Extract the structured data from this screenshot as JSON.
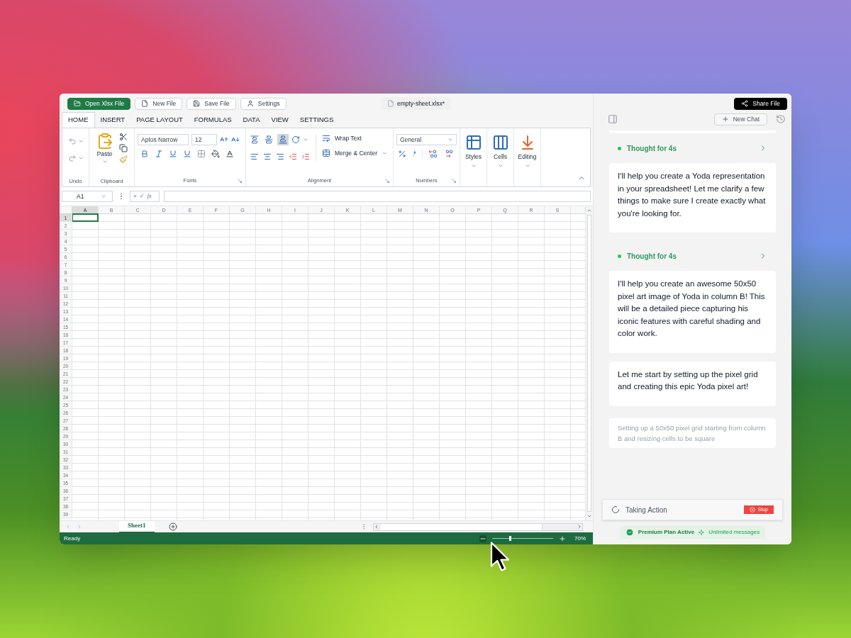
{
  "toolbar": {
    "buttons": [
      {
        "label": "Open Xlsx File",
        "kind": "primary"
      },
      {
        "label": "New File",
        "kind": "default"
      },
      {
        "label": "Save File",
        "kind": "default"
      },
      {
        "label": "Settings",
        "kind": "default"
      }
    ],
    "file_name": "empty-sheet.xlsx*"
  },
  "ribbon": {
    "tabs": [
      {
        "label": "HOME",
        "selected": true
      },
      {
        "label": "INSERT",
        "selected": false
      },
      {
        "label": "PAGE LAYOUT",
        "selected": false
      },
      {
        "label": "FORMULAS",
        "selected": false
      },
      {
        "label": "DATA",
        "selected": false
      },
      {
        "label": "VIEW",
        "selected": false
      },
      {
        "label": "SETTINGS",
        "selected": false
      }
    ],
    "undo": {
      "label": "Undo"
    },
    "clipboard": {
      "label": "Clipboard",
      "paste": "Paste"
    },
    "fonts": {
      "label": "Fonts",
      "font": "Aptos Narrow",
      "size": "12"
    },
    "alignment": {
      "label": "Alignment",
      "wrap_text": "Wrap Text",
      "merge": "Merge & Center",
      "vertical_align": [
        {
          "selected": false
        },
        {
          "selected": false
        },
        {
          "selected": true
        }
      ]
    },
    "numbers": {
      "label": "Numbers",
      "format": "General"
    },
    "styles": "Styles",
    "cells": "Cells",
    "editing": "Editing"
  },
  "formula_bar": {
    "cell_ref": "A1",
    "cancel": "×",
    "confirm": "✓",
    "fx": "fx"
  },
  "sheet": {
    "columns": [
      {
        "label": "A",
        "selected": true
      },
      {
        "label": "B",
        "selected": false
      },
      {
        "label": "C",
        "selected": false
      },
      {
        "label": "D",
        "selected": false
      },
      {
        "label": "E",
        "selected": false
      },
      {
        "label": "F",
        "selected": false
      },
      {
        "label": "G",
        "selected": false
      },
      {
        "label": "H",
        "selected": false
      },
      {
        "label": "I",
        "selected": false
      },
      {
        "label": "J",
        "selected": false
      },
      {
        "label": "K",
        "selected": false
      },
      {
        "label": "L",
        "selected": false
      },
      {
        "label": "M",
        "selected": false
      },
      {
        "label": "N",
        "selected": false
      },
      {
        "label": "O",
        "selected": false
      },
      {
        "label": "P",
        "selected": false
      },
      {
        "label": "Q",
        "selected": false
      },
      {
        "label": "R",
        "selected": false
      },
      {
        "label": "S",
        "selected": false
      }
    ],
    "rows": [
      {
        "label": "1",
        "selected": true
      },
      {
        "label": "2",
        "selected": false
      },
      {
        "label": "3",
        "selected": false
      },
      {
        "label": "4",
        "selected": false
      },
      {
        "label": "5",
        "selected": false
      },
      {
        "label": "6",
        "selected": false
      },
      {
        "label": "7",
        "selected": false
      },
      {
        "label": "8",
        "selected": false
      },
      {
        "label": "9",
        "selected": false
      },
      {
        "label": "10",
        "selected": false
      },
      {
        "label": "11",
        "selected": false
      },
      {
        "label": "12",
        "selected": false
      },
      {
        "label": "13",
        "selected": false
      },
      {
        "label": "14",
        "selected": false
      },
      {
        "label": "15",
        "selected": false
      },
      {
        "label": "16",
        "selected": false
      },
      {
        "label": "17",
        "selected": false
      },
      {
        "label": "18",
        "selected": false
      },
      {
        "label": "19",
        "selected": false
      },
      {
        "label": "20",
        "selected": false
      },
      {
        "label": "21",
        "selected": false
      },
      {
        "label": "22",
        "selected": false
      },
      {
        "label": "23",
        "selected": false
      },
      {
        "label": "24",
        "selected": false
      },
      {
        "label": "25",
        "selected": false
      },
      {
        "label": "26",
        "selected": false
      },
      {
        "label": "27",
        "selected": false
      },
      {
        "label": "28",
        "selected": false
      },
      {
        "label": "29",
        "selected": false
      },
      {
        "label": "30",
        "selected": false
      },
      {
        "label": "31",
        "selected": false
      },
      {
        "label": "32",
        "selected": false
      },
      {
        "label": "33",
        "selected": false
      },
      {
        "label": "34",
        "selected": false
      },
      {
        "label": "35",
        "selected": false
      },
      {
        "label": "36",
        "selected": false
      },
      {
        "label": "37",
        "selected": false
      },
      {
        "label": "38",
        "selected": false
      },
      {
        "label": "39",
        "selected": false
      }
    ]
  },
  "sheet_tabs": [
    {
      "label": "Sheet1",
      "selected": true
    }
  ],
  "status_bar": {
    "status": "Ready",
    "zoom": {
      "level": 0.28,
      "reading": "70%"
    }
  },
  "chat": {
    "share_button": "Share File",
    "new_chat": "New Chat",
    "messages": [
      {
        "kind": "thought",
        "text": "Thought for 4s"
      },
      {
        "kind": "message",
        "text": "I'll help you create a Yoda representation in your spreadsheet! Let me clarify a few things to make sure I create exactly what you're looking for."
      },
      {
        "kind": "thought",
        "text": "Thought for 4s"
      },
      {
        "kind": "message",
        "text": "I'll help you create an awesome 50x50 pixel art image of Yoda in column B! This will be a detailed piece capturing his iconic features with careful shading and color work."
      },
      {
        "kind": "message",
        "text": "Let me start by setting up the pixel grid and creating this epic Yoda pixel art!"
      },
      {
        "kind": "action",
        "text": "Setting up a 50x50 pixel grid starting from column B and resizing cells to be square"
      }
    ],
    "action": {
      "label": "Taking Action",
      "stop": "Stop"
    },
    "plan": {
      "label": "Premium Plan Active",
      "extra": "Unlimited messages"
    }
  }
}
